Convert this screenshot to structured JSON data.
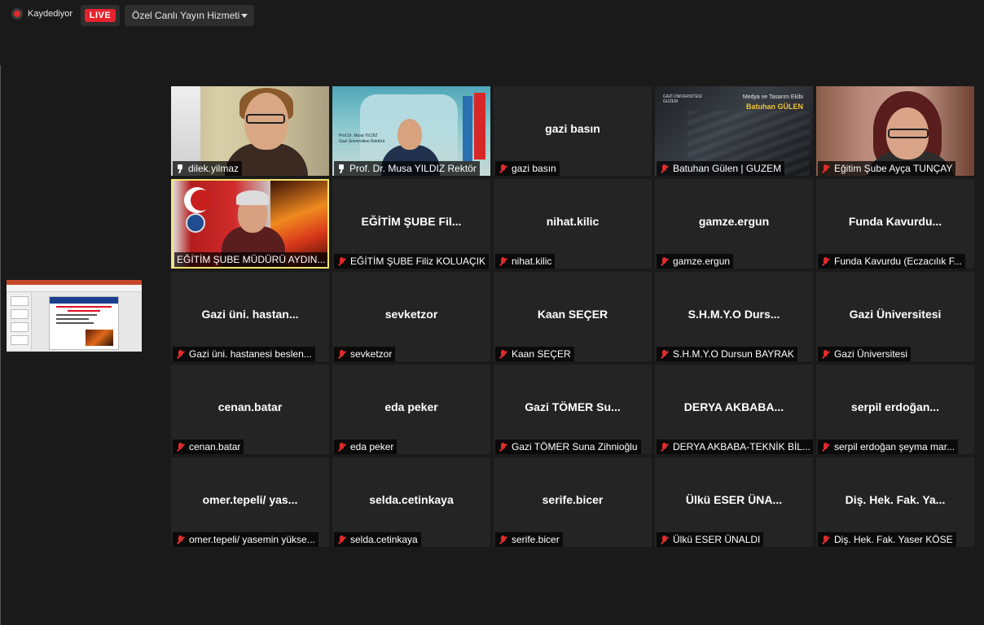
{
  "topbar": {
    "recording_label": "Kaydediyor",
    "live_label": "LIVE",
    "stream_service": "Özel Canlı Yayın Hizmeti"
  },
  "colors": {
    "background": "#1a1a1a",
    "tile": "#242424",
    "live_red": "#e8232f",
    "active_speaker_border": "#f5e46e",
    "muted_red": "#e02b2b"
  },
  "participants": [
    {
      "display": "",
      "label": "dilek.yilmaz",
      "icon": "pin-icon",
      "video": "dilek"
    },
    {
      "display": "",
      "label": "Prof. Dr. Musa YILDIZ Rektör",
      "icon": "pin-icon",
      "video": "rektor",
      "overlay": [
        "Prof.Dr. Musa YILDIZ",
        "Gazi Üniversitesi Rektörü"
      ]
    },
    {
      "display": "gazi basın",
      "label": "gazi basın",
      "icon": "mic-muted-icon"
    },
    {
      "display": "",
      "label": "Batuhan Gülen | GUZEM",
      "icon": "mic-muted-icon",
      "video": "gulen",
      "overlay": [
        "Medya ve Tasarım Ekibi",
        "Batuhan GÜLEN",
        "GAZİ ÜNİVERSİTESİ",
        "GUZEM"
      ]
    },
    {
      "display": "",
      "label": "Eğitim Şube Ayça TUNÇAY",
      "icon": "mic-muted-icon",
      "video": "aycan"
    },
    {
      "display": "",
      "label": "EĞİTİM ŞUBE MÜDÜRÜ AYDIN...",
      "icon": "none",
      "video": "aydin",
      "active": true
    },
    {
      "display": "EĞİTİM ŞUBE Fil...",
      "label": "EĞİTİM ŞUBE Filiz KOLUAÇIK",
      "icon": "mic-muted-icon"
    },
    {
      "display": "nihat.kilic",
      "label": "nihat.kilic",
      "icon": "mic-muted-icon"
    },
    {
      "display": "gamze.ergun",
      "label": "gamze.ergun",
      "icon": "mic-muted-icon"
    },
    {
      "display": "Funda Kavurdu...",
      "label": "Funda Kavurdu (Eczacılık F...",
      "icon": "mic-muted-icon"
    },
    {
      "display": "Gazi üni. hastan...",
      "label": "Gazi üni. hastanesi beslen...",
      "icon": "mic-muted-icon"
    },
    {
      "display": "sevketzor",
      "label": "sevketzor",
      "icon": "mic-muted-icon"
    },
    {
      "display": "Kaan SEÇER",
      "label": "Kaan SEÇER",
      "icon": "mic-muted-icon"
    },
    {
      "display": "S.H.M.Y.O Durs...",
      "label": "S.H.M.Y.O Dursun BAYRAK",
      "icon": "mic-muted-icon"
    },
    {
      "display": "Gazi Üniversitesi",
      "label": "Gazi Üniversitesi",
      "icon": "mic-muted-icon"
    },
    {
      "display": "cenan.batar",
      "label": "cenan.batar",
      "icon": "mic-muted-icon"
    },
    {
      "display": "eda peker",
      "label": "eda peker",
      "icon": "mic-muted-icon"
    },
    {
      "display": "Gazi TÖMER Su...",
      "label": "Gazi TÖMER Suna Zihnioğlu",
      "icon": "mic-muted-icon"
    },
    {
      "display": "DERYA AKBABA...",
      "label": "DERYA AKBABA-TEKNİK BİL...",
      "icon": "mic-muted-icon"
    },
    {
      "display": "serpil erdoğan...",
      "label": "serpil erdoğan şeyma mar...",
      "icon": "mic-muted-icon"
    },
    {
      "display": "omer.tepeli/ yas...",
      "label": "omer.tepeli/ yasemin yükse...",
      "icon": "mic-muted-icon"
    },
    {
      "display": "selda.cetinkaya",
      "label": "selda.cetinkaya",
      "icon": "mic-muted-icon"
    },
    {
      "display": "serife.bicer",
      "label": "serife.bicer",
      "icon": "mic-muted-icon"
    },
    {
      "display": "Ülkü ESER ÜNA...",
      "label": "Ülkü ESER ÜNALDI",
      "icon": "mic-muted-icon"
    },
    {
      "display": "Diş. Hek. Fak. Ya...",
      "label": "Diş. Hek. Fak. Yaser KÖSE",
      "icon": "mic-muted-icon"
    }
  ]
}
